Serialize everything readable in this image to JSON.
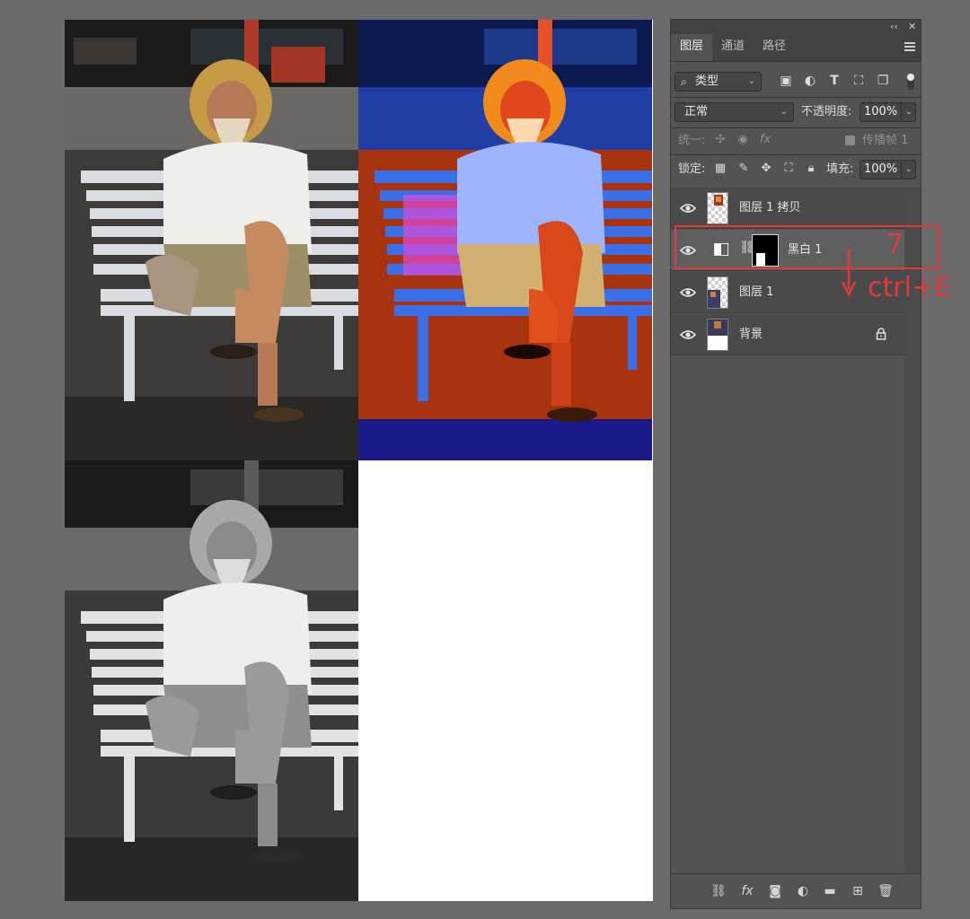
{
  "panel": {
    "collapse_glyph": "‹‹",
    "close_glyph": "✕",
    "tabs": [
      {
        "label": "图层"
      },
      {
        "label": "通道"
      },
      {
        "label": "路径"
      }
    ],
    "filter": {
      "label": "类型"
    },
    "blend_mode": "正常",
    "opacity_label": "不透明度:",
    "opacity_value": "100%",
    "unify_label": "统一:",
    "propagate_label": "传播帧 1",
    "lock_label": "锁定:",
    "fill_label": "填充:",
    "fill_value": "100%",
    "layers": [
      {
        "name": "图层 1 拷贝"
      },
      {
        "name": "黑白 1"
      },
      {
        "name": "图层 1"
      },
      {
        "name": "背景"
      }
    ]
  },
  "annotation": {
    "step_number": "7",
    "shortcut": "ctrl+E",
    "color": "#e23a3a"
  }
}
